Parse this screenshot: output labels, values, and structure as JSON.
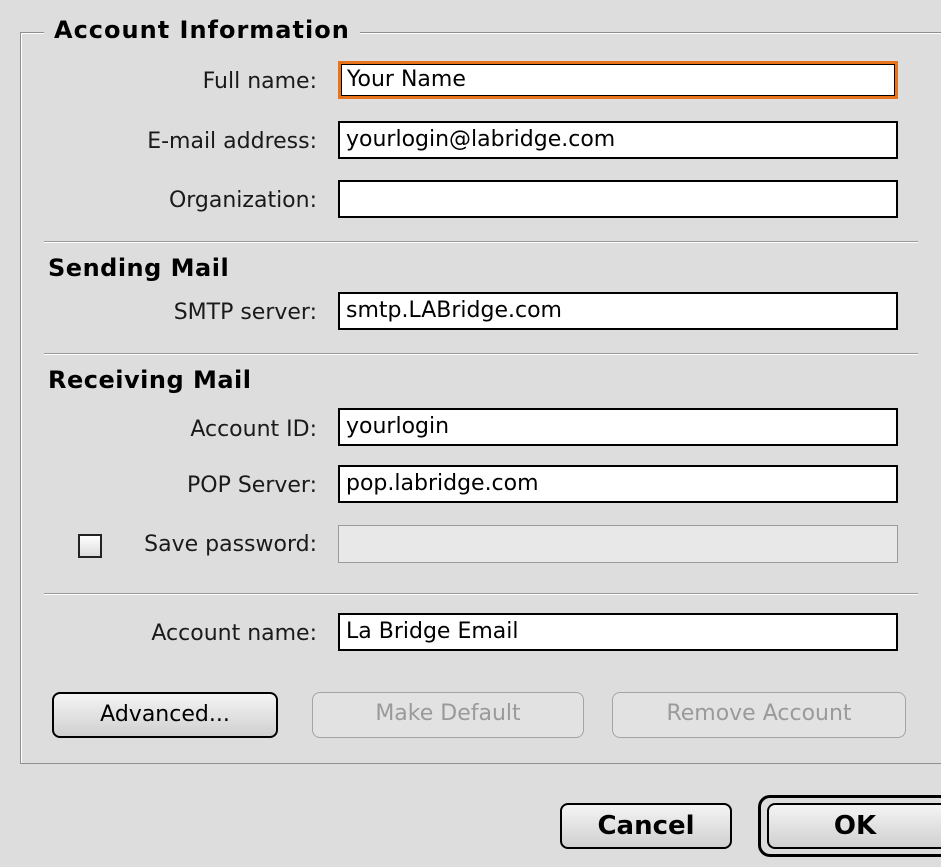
{
  "dialog": {
    "group_title": "Account Information",
    "sections": {
      "sending": "Sending Mail",
      "receiving": "Receiving Mail"
    }
  },
  "fields": {
    "full_name": {
      "label": "Full name:",
      "value": "Your Name"
    },
    "email": {
      "label": "E-mail address:",
      "value": "yourlogin@labridge.com"
    },
    "organization": {
      "label": "Organization:",
      "value": ""
    },
    "smtp_server": {
      "label": "SMTP server:",
      "value": "smtp.LABridge.com"
    },
    "account_id": {
      "label": "Account ID:",
      "value": "yourlogin"
    },
    "pop_server": {
      "label": "POP Server:",
      "value": "pop.labridge.com"
    },
    "save_password": {
      "label": "Save password:",
      "checked": false,
      "value": ""
    },
    "account_name": {
      "label": "Account name:",
      "value": "La Bridge Email"
    }
  },
  "buttons": {
    "advanced": "Advanced...",
    "make_default": "Make Default",
    "remove_account": "Remove Account",
    "cancel": "Cancel",
    "ok": "OK"
  },
  "colors": {
    "focus_ring": "#e8731a",
    "background": "#dddddd"
  }
}
